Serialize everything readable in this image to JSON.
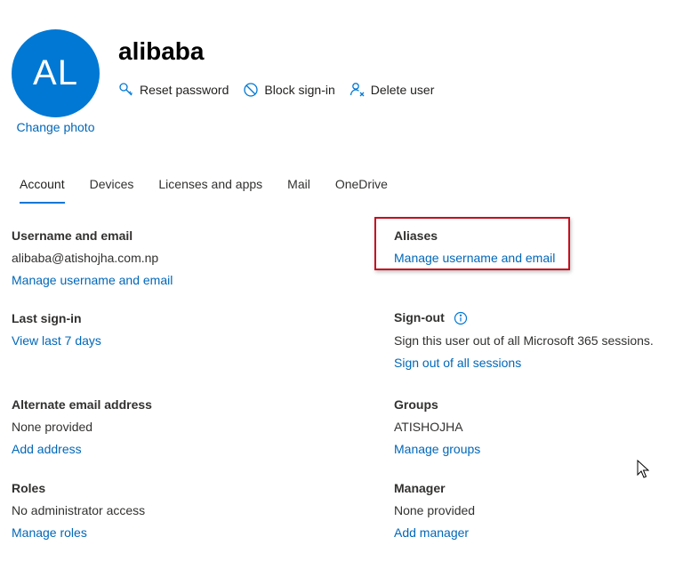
{
  "user": {
    "initials": "AL",
    "name": "alibaba",
    "change_photo": "Change photo",
    "avatar_color": "#0078d4"
  },
  "actions": [
    {
      "label": "Reset password",
      "icon": "key-icon"
    },
    {
      "label": "Block sign-in",
      "icon": "block-icon"
    },
    {
      "label": "Delete user",
      "icon": "delete-user-icon"
    }
  ],
  "tabs": [
    {
      "label": "Account",
      "active": true
    },
    {
      "label": "Devices",
      "active": false
    },
    {
      "label": "Licenses and apps",
      "active": false
    },
    {
      "label": "Mail",
      "active": false
    },
    {
      "label": "OneDrive",
      "active": false
    }
  ],
  "sections": {
    "username": {
      "title": "Username and email",
      "value": "alibaba@atishojha.com.np",
      "link": "Manage username and email"
    },
    "aliases": {
      "title": "Aliases",
      "link": "Manage username and email"
    },
    "last_signin": {
      "title": "Last sign-in",
      "link": "View last 7 days"
    },
    "signout": {
      "title": "Sign-out",
      "value": "Sign this user out of all Microsoft 365 sessions.",
      "link": "Sign out of all sessions"
    },
    "alt_email": {
      "title": "Alternate email address",
      "value": "None provided",
      "link": "Add address"
    },
    "groups": {
      "title": "Groups",
      "value": "ATISHOJHA",
      "link": "Manage groups"
    },
    "roles": {
      "title": "Roles",
      "value": "No administrator access",
      "link": "Manage roles"
    },
    "manager": {
      "title": "Manager",
      "value": "None provided",
      "link": "Add manager"
    }
  },
  "colors": {
    "link": "#0067b8",
    "accent": "#0078d4",
    "highlight_border": "#c50f1f"
  }
}
